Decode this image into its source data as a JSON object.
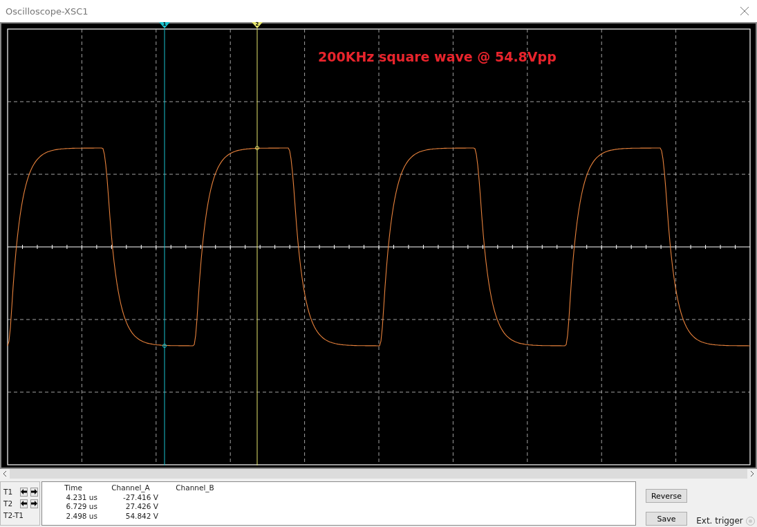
{
  "window": {
    "title": "Oscilloscope-XSC1"
  },
  "screen": {
    "annotation": "200KHz square wave @ 54.8Vpp",
    "cursors": [
      {
        "label": "1",
        "color": "#19c3cf"
      },
      {
        "label": "2",
        "color": "#e6e66e"
      }
    ]
  },
  "readout": {
    "columns": [
      "Time",
      "Channel_A",
      "Channel_B"
    ],
    "rows": [
      {
        "label": "T1",
        "kind": "cursor",
        "cells": [
          "4.231 us",
          "-27.416 V"
        ]
      },
      {
        "label": "T2",
        "kind": "cursor",
        "cells": [
          "6.729 us",
          "27.426 V"
        ]
      },
      {
        "label": "T2-T1",
        "kind": "difference",
        "cells": [
          "2.498 us",
          "54.842 V"
        ]
      }
    ]
  },
  "buttons": [
    "Reverse",
    "Save"
  ],
  "ext_trigger": {
    "label": "Ext. trigger",
    "selected": false
  }
}
